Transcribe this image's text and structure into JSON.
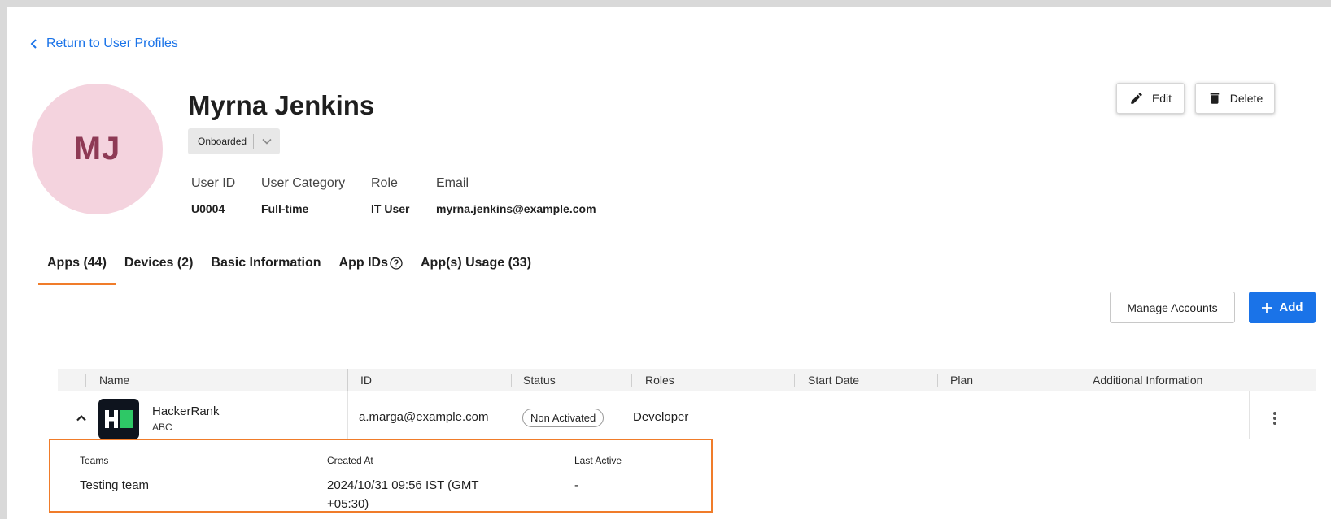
{
  "back_link": {
    "label": "Return to User Profiles"
  },
  "profile": {
    "initials": "MJ",
    "name": "Myrna Jenkins",
    "status": "Onboarded",
    "fields": [
      {
        "label": "User ID",
        "value": "U0004"
      },
      {
        "label": "User Category",
        "value": "Full-time"
      },
      {
        "label": "Role",
        "value": "IT User"
      },
      {
        "label": "Email",
        "value": "myrna.jenkins@example.com"
      }
    ]
  },
  "actions": {
    "edit": "Edit",
    "delete": "Delete"
  },
  "tabs": [
    {
      "label": "Apps (44)",
      "active": true
    },
    {
      "label": "Devices (2)"
    },
    {
      "label": "Basic Information"
    },
    {
      "label": "App IDs"
    },
    {
      "label": "App(s) Usage (33)"
    }
  ],
  "toolbar": {
    "manage_accounts": "Manage Accounts",
    "add": "Add"
  },
  "table": {
    "columns": [
      "Name",
      "ID",
      "Status",
      "Roles",
      "Start Date",
      "Plan",
      "Additional Information"
    ],
    "rows": [
      {
        "name": "HackerRank",
        "subtitle": "ABC",
        "id": "a.marga@example.com",
        "status": "Non Activated",
        "roles": "Developer",
        "start_date": "",
        "plan": "",
        "additional_information": ""
      }
    ],
    "expanded_detail": {
      "teams_label": "Teams",
      "teams_value": "Testing team",
      "created_label": "Created At",
      "created_value": "2024/10/31 09:56 IST (GMT +05:30)",
      "last_active_label": "Last Active",
      "last_active_value": "-"
    }
  },
  "colors": {
    "accent": "#1a73e8",
    "tab_indicator": "#f07c2a",
    "avatar_bg": "#f4d3de",
    "avatar_text": "#8e3a55",
    "highlight_border": "#f07c2a"
  }
}
